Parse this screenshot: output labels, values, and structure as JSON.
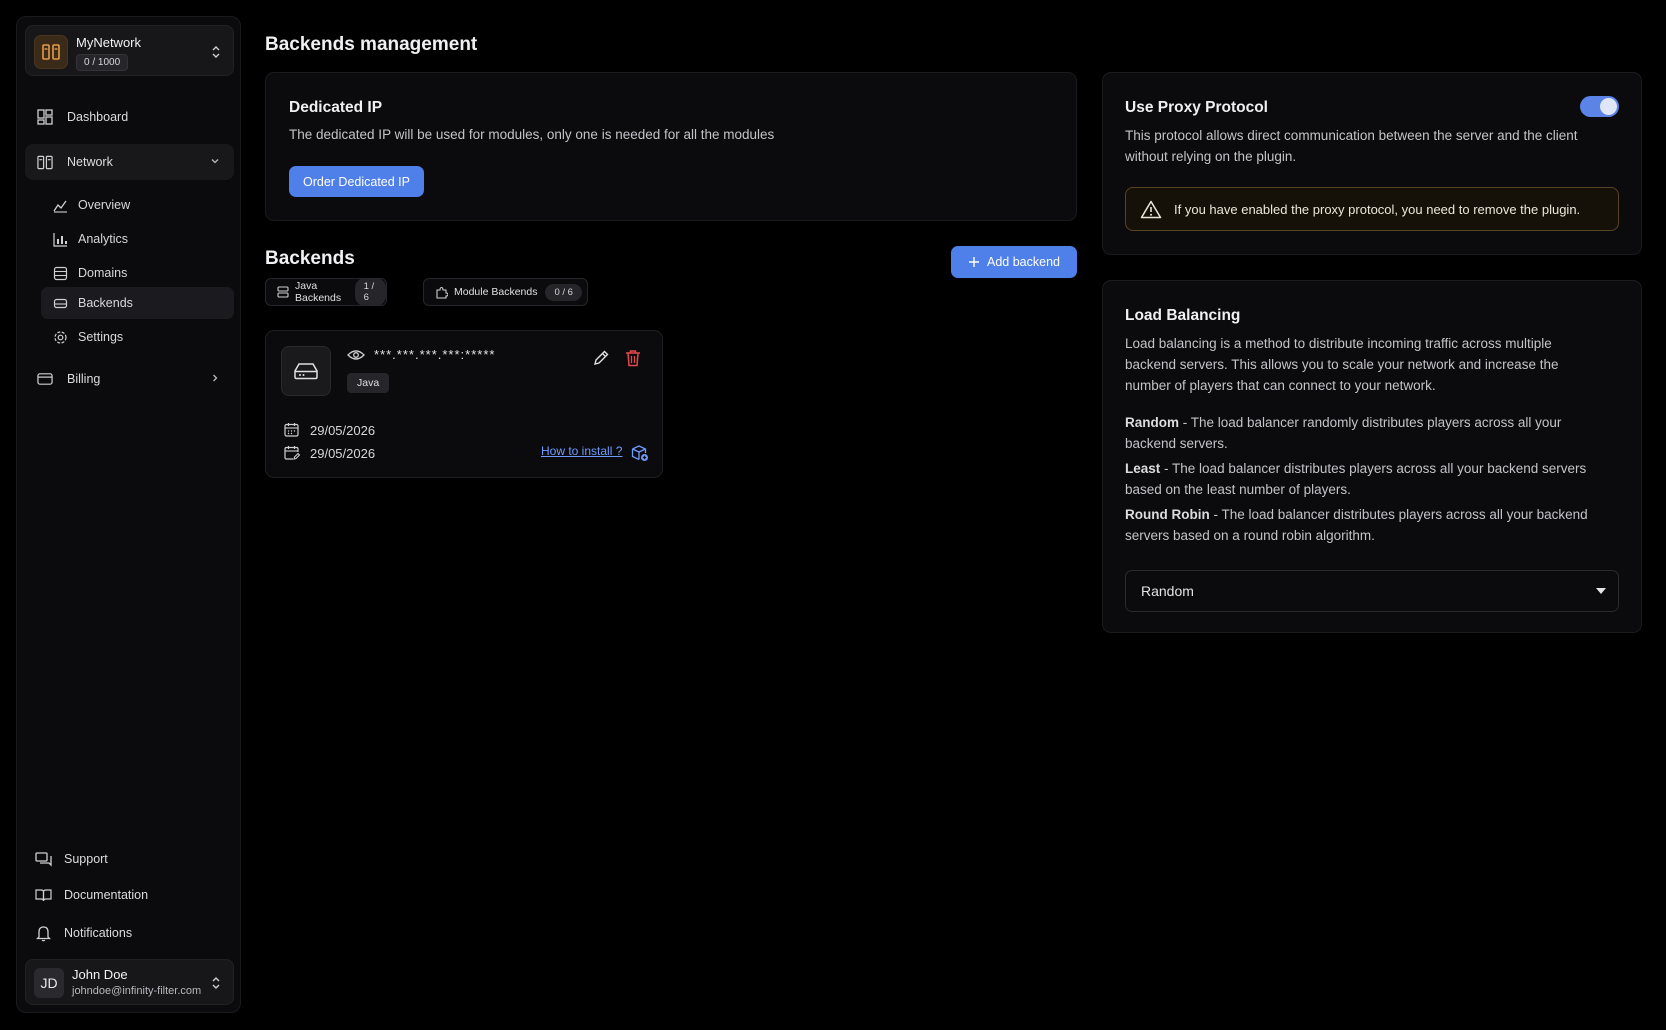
{
  "sidebar": {
    "network": {
      "name": "MyNetwork",
      "count": "0 / 1000"
    },
    "items": [
      {
        "label": "Dashboard",
        "icon": "dashboard-icon"
      },
      {
        "label": "Network",
        "icon": "network-icon"
      },
      {
        "label": "Billing",
        "icon": "credit-card-icon"
      }
    ],
    "subitems": [
      {
        "label": "Overview",
        "icon": "overview-chart-icon"
      },
      {
        "label": "Analytics",
        "icon": "bar-chart-icon"
      },
      {
        "label": "Domains",
        "icon": "domains-icon"
      },
      {
        "label": "Backends",
        "icon": "hard-drive-icon"
      },
      {
        "label": "Settings",
        "icon": "gear-icon"
      }
    ],
    "bottom": [
      {
        "label": "Support",
        "icon": "chat-icon"
      },
      {
        "label": "Documentation",
        "icon": "book-icon"
      },
      {
        "label": "Notifications",
        "icon": "bell-icon"
      }
    ],
    "user": {
      "initials": "JD",
      "name": "John Doe",
      "email": "johndoe@infinity-filter.com"
    }
  },
  "main": {
    "title": "Backends management",
    "dedicated_ip": {
      "title": "Dedicated IP",
      "description": "The dedicated IP will be used for modules, only one is needed for all the modules",
      "button": "Order Dedicated IP"
    },
    "backends": {
      "title": "Backends",
      "add_button": "Add backend",
      "tabs": [
        {
          "label": "Java Backends",
          "count": "1 / 6"
        },
        {
          "label": "Module Backends",
          "count": "0 / 6"
        }
      ],
      "card": {
        "ip": "***.***.***.***:*****",
        "tag": "Java",
        "created": "29/05/2026",
        "updated": "29/05/2026",
        "how_to": "How to install ?"
      }
    },
    "proxy": {
      "title": "Use Proxy Protocol",
      "enabled": true,
      "description_1": "This protocol allows direct communication between the server and the client",
      "description_2": "without relying on the plugin.",
      "warning": "If you have enabled the proxy protocol, you need to remove the plugin."
    },
    "load_balancing": {
      "title": "Load Balancing",
      "description_1": "Load balancing is a method to distribute incoming traffic across multiple",
      "description_2": "backend servers. This allows you to scale your network and increase the",
      "description_3": "number of players that can connect to your network.",
      "modes": [
        {
          "name": "Random",
          "line_1": " - The load balancer randomly distributes players across all your",
          "line_2": "backend servers."
        },
        {
          "name": "Least",
          "line_1": " - The load balancer distributes players across all your backend servers",
          "line_2": "based on the least number of players."
        },
        {
          "name": "Round Robin",
          "line_1": " - The load balancer distributes players across all your backend",
          "line_2": "servers based on a round robin algorithm."
        }
      ],
      "selected": "Random"
    }
  },
  "colors": {
    "accent": "#4f7fe8",
    "danger": "#e5484d",
    "warning_border": "#5a4322"
  }
}
